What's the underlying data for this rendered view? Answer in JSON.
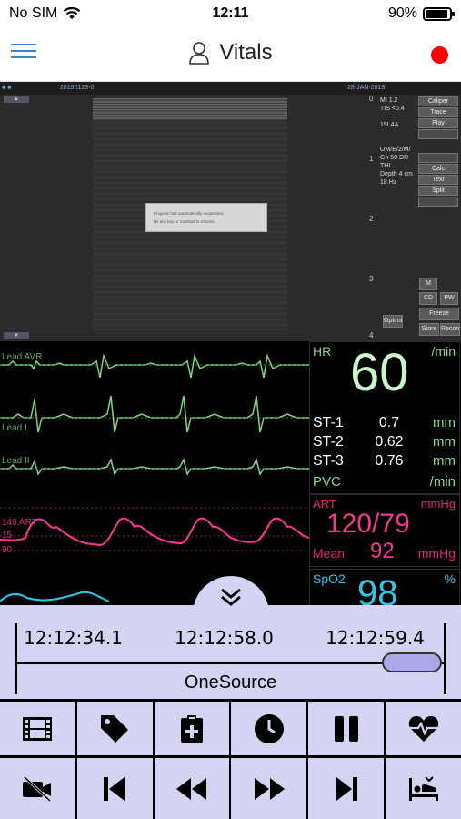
{
  "status": {
    "carrier": "No SIM",
    "time": "12:11",
    "battery": "90%"
  },
  "nav": {
    "title": "Vitals",
    "record_color": "#ff0000"
  },
  "ultrasound": {
    "header_date": "20190123-0",
    "header_date2": "28-JAN-2019",
    "dialog_line1": "Program has automatically suspended",
    "dialog_line2": "Hit any key or trackball to resume.",
    "params": [
      "MI  1.2",
      "TIS <0.4",
      "",
      "15L4A",
      "",
      "",
      "OM/E/2/M/",
      "Gn 50  DR",
      "THI",
      "Depth 4 cm",
      "18 Hz"
    ],
    "buttons": [
      "Caliper",
      "Trace",
      "Play",
      "",
      "",
      "Calc",
      "Text",
      "Split"
    ],
    "mode_m": "M",
    "mode_cd": "CD",
    "mode_pw": "PW",
    "freeze": "Freeze",
    "store": "Store",
    "record": "Record",
    "optimize": "Optimize",
    "depth_marks": [
      "0",
      "1",
      "2",
      "3",
      "4"
    ]
  },
  "monitor": {
    "leads": [
      "Lead AVR",
      "Lead I",
      "Lead II"
    ],
    "hr": {
      "label": "HR",
      "unit": "/min",
      "value": "60"
    },
    "st": [
      {
        "label": "ST-1",
        "value": "0.7",
        "unit": "mm"
      },
      {
        "label": "ST-2",
        "value": "0.62",
        "unit": "mm"
      },
      {
        "label": "ST-3",
        "value": "0.76",
        "unit": "mm"
      }
    ],
    "pvc": {
      "label": "PVC",
      "unit": "/min"
    },
    "art": {
      "label": "ART",
      "unit": "mmHg",
      "value": "120/79",
      "mean_label": "Mean",
      "mean_value": "92",
      "mean_unit": "mmHg",
      "scale": [
        "140 ART",
        "15",
        "90"
      ]
    },
    "spo2": {
      "label": "SpO2",
      "unit": "%",
      "value": "98"
    },
    "colors": {
      "ecg": "#7fd67f",
      "art": "#ff3399",
      "spo2": "#2ac8e8"
    }
  },
  "timeline": {
    "start": "12:12:34.1",
    "mid": "12:12:58.0",
    "end": "12:12:59.4",
    "source": "OneSource",
    "position": 0.94
  },
  "toolbar_top": [
    {
      "name": "film-icon"
    },
    {
      "name": "tag-icon"
    },
    {
      "name": "clipboard-icon"
    },
    {
      "name": "clock-icon"
    },
    {
      "name": "pause-icon"
    },
    {
      "name": "heart-pulse-icon"
    }
  ],
  "toolbar_bottom": [
    {
      "name": "video-off-icon"
    },
    {
      "name": "skip-back-icon"
    },
    {
      "name": "rewind-icon"
    },
    {
      "name": "fast-forward-icon"
    },
    {
      "name": "skip-forward-icon"
    },
    {
      "name": "patient-bed-icon"
    }
  ]
}
